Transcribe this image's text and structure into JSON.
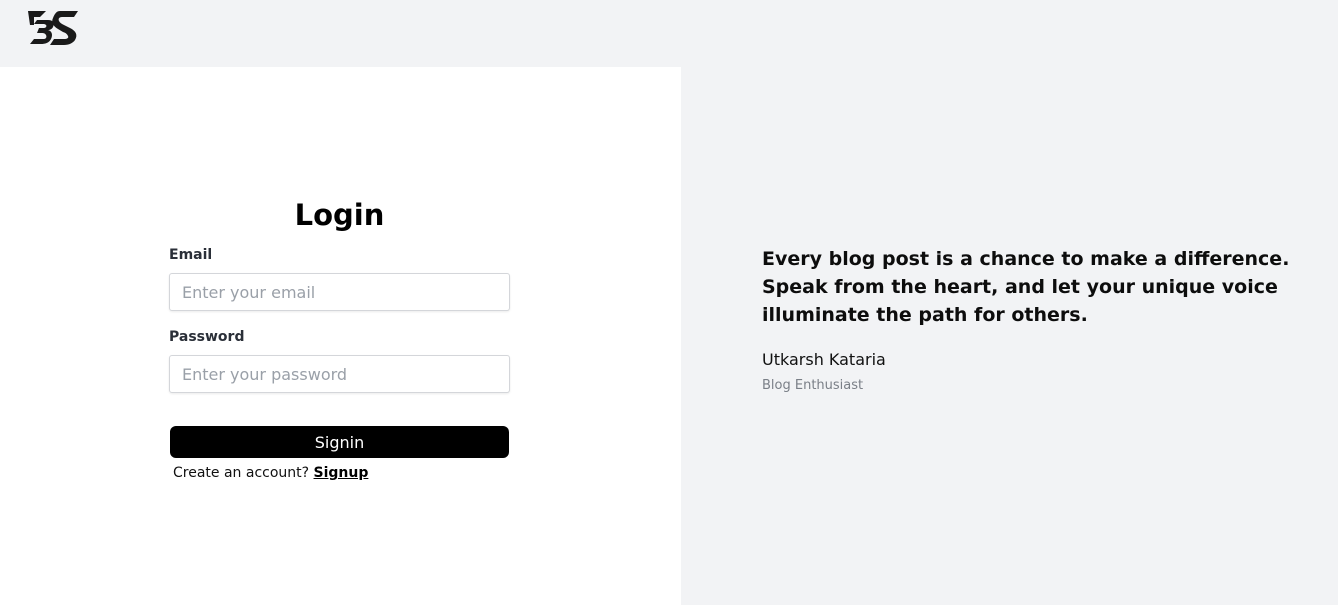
{
  "brand": {
    "logo_icon": "bs-logo-icon"
  },
  "login": {
    "title": "Login",
    "email": {
      "label": "Email",
      "placeholder": "Enter your email",
      "value": ""
    },
    "password": {
      "label": "Password",
      "placeholder": "Enter your password",
      "value": ""
    },
    "signin_label": "Signin",
    "signup_prompt": "Create an account?",
    "signup_link": "Signup"
  },
  "testimonial": {
    "quote": "Every blog post is a chance to make a difference. Speak from the heart, and let your unique voice illuminate the path for others.",
    "author": "Utkarsh Kataria",
    "role": "Blog Enthusiast"
  },
  "colors": {
    "button": "#000000",
    "panel_bg": "#f2f3f5",
    "form_bg": "#ffffff"
  }
}
